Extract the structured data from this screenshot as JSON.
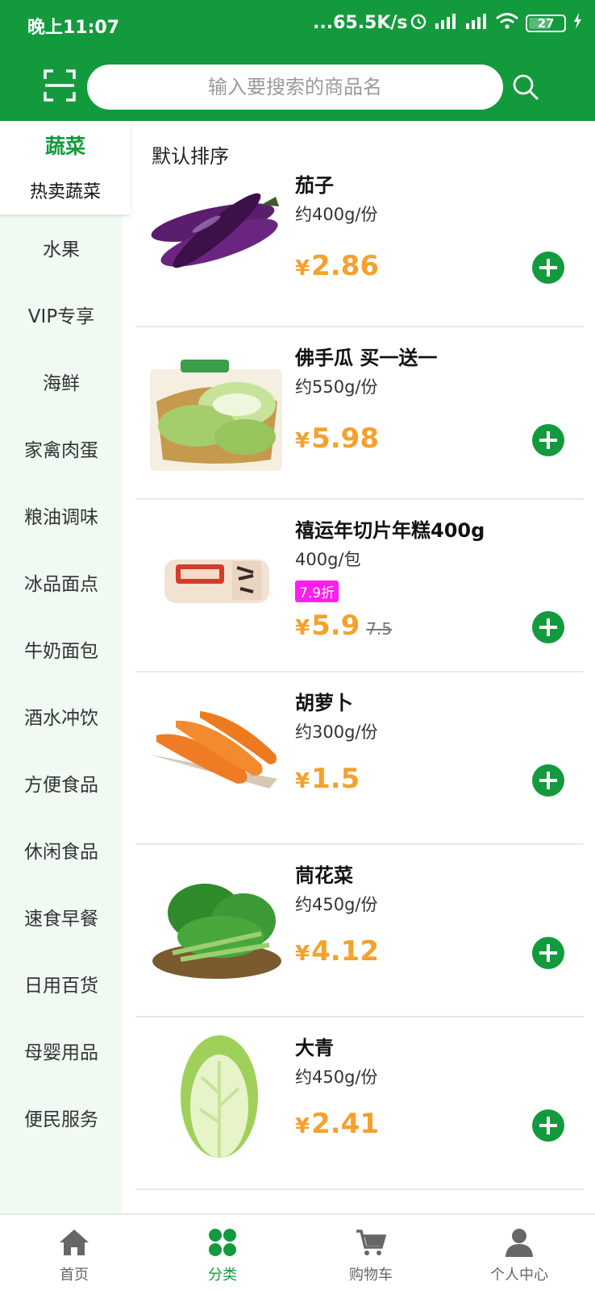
{
  "status": {
    "time": "晚上11:07",
    "net_speed": "...65.5K/s",
    "battery": "27"
  },
  "search": {
    "placeholder": "输入要搜索的商品名"
  },
  "sidebar": {
    "active": {
      "label": "蔬菜",
      "sub": "热卖蔬菜"
    },
    "items": [
      "水果",
      "VIP专享",
      "海鲜",
      "家禽肉蛋",
      "粮油调味",
      "冰品面点",
      "牛奶面包",
      "酒水冲饮",
      "方便食品",
      "休闲食品",
      "速食早餐",
      "日用百货",
      "母婴用品",
      "便民服务"
    ]
  },
  "sort_label": "默认排序",
  "products": [
    {
      "name": "茄子",
      "spec": "约400g/份",
      "price": "2.86",
      "currency": "¥"
    },
    {
      "name": "佛手瓜 买一送一",
      "spec": "约550g/份",
      "price": "5.98",
      "currency": "¥"
    },
    {
      "name": "禧运年切片年糕400g",
      "spec": "400g/包",
      "discount": "7.9折",
      "price": "5.9",
      "original_price": "7.5",
      "currency": "¥"
    },
    {
      "name": "胡萝卜",
      "spec": "约300g/份",
      "price": "1.5",
      "currency": "¥"
    },
    {
      "name": "茼花菜",
      "spec": "约450g/份",
      "price": "4.12",
      "currency": "¥"
    },
    {
      "name": "大青",
      "spec": "约450g/份",
      "price": "2.41",
      "currency": "¥"
    }
  ],
  "tabs": [
    {
      "label": "首页",
      "icon": "home-icon"
    },
    {
      "label": "分类",
      "icon": "category-icon",
      "active": true
    },
    {
      "label": "购物车",
      "icon": "cart-icon"
    },
    {
      "label": "个人中心",
      "icon": "profile-icon"
    }
  ],
  "colors": {
    "brand": "#139a3d",
    "price": "#f5a12c",
    "discount": "#ff1df0"
  }
}
